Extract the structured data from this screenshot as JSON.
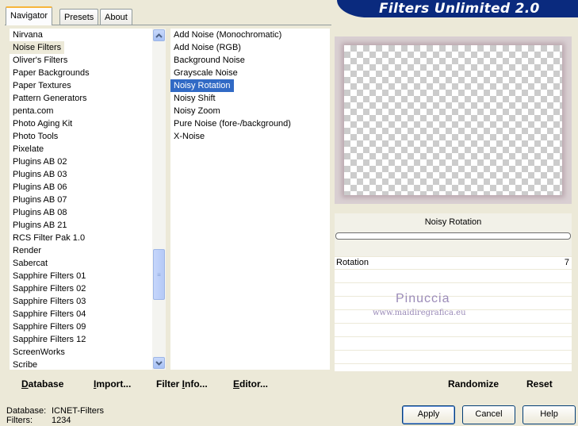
{
  "app": {
    "title": "Filters Unlimited 2.0"
  },
  "tabs": [
    {
      "label": "Navigator",
      "active": true
    },
    {
      "label": "Presets",
      "active": false
    },
    {
      "label": "About",
      "active": false
    }
  ],
  "categories": {
    "items": [
      "Nirvana",
      "Noise Filters",
      "Oliver's Filters",
      "Paper Backgrounds",
      "Paper Textures",
      "Pattern Generators",
      "penta.com",
      "Photo Aging Kit",
      "Photo Tools",
      "Pixelate",
      "Plugins AB 02",
      "Plugins AB 03",
      "Plugins AB 06",
      "Plugins AB 07",
      "Plugins AB 08",
      "Plugins AB 21",
      "RCS Filter Pak 1.0",
      "Render",
      "Sabercat",
      "Sapphire Filters 01",
      "Sapphire Filters 02",
      "Sapphire Filters 03",
      "Sapphire Filters 04",
      "Sapphire Filters 09",
      "Sapphire Filters 12",
      "ScreenWorks",
      "Scribe"
    ],
    "selected": "Noise Filters"
  },
  "filters": {
    "items": [
      "Add Noise (Monochromatic)",
      "Add Noise (RGB)",
      "Background Noise",
      "Grayscale Noise",
      "Noisy Rotation",
      "Noisy Shift",
      "Noisy Zoom",
      "Pure Noise (fore-/background)",
      "X-Noise"
    ],
    "selected": "Noisy Rotation"
  },
  "settings": {
    "filter_name": "Noisy Rotation",
    "params": [
      {
        "label": "Rotation",
        "value": "7"
      }
    ]
  },
  "watermark": {
    "name": "Pinuccia",
    "url": "www.maidiregrafica.eu"
  },
  "toolbar": {
    "database": {
      "first": "D",
      "rest": "atabase"
    },
    "import": {
      "first": "I",
      "rest": "mport..."
    },
    "filter_info": {
      "before": "Filter ",
      "first": "I",
      "rest": "nfo..."
    },
    "editor": {
      "first": "E",
      "rest": "ditor..."
    },
    "randomize": "Randomize",
    "reset": "Reset"
  },
  "status": {
    "database_label": "Database:",
    "database_value": "ICNET-Filters",
    "filters_label": "Filters:",
    "filters_value": "1234"
  },
  "buttons": {
    "apply": "Apply",
    "cancel": "Cancel",
    "help": "Help"
  },
  "colors": {
    "banner": "#0a2a7e",
    "selection": "#316ac5",
    "dialog_bg": "#ece9d8"
  }
}
